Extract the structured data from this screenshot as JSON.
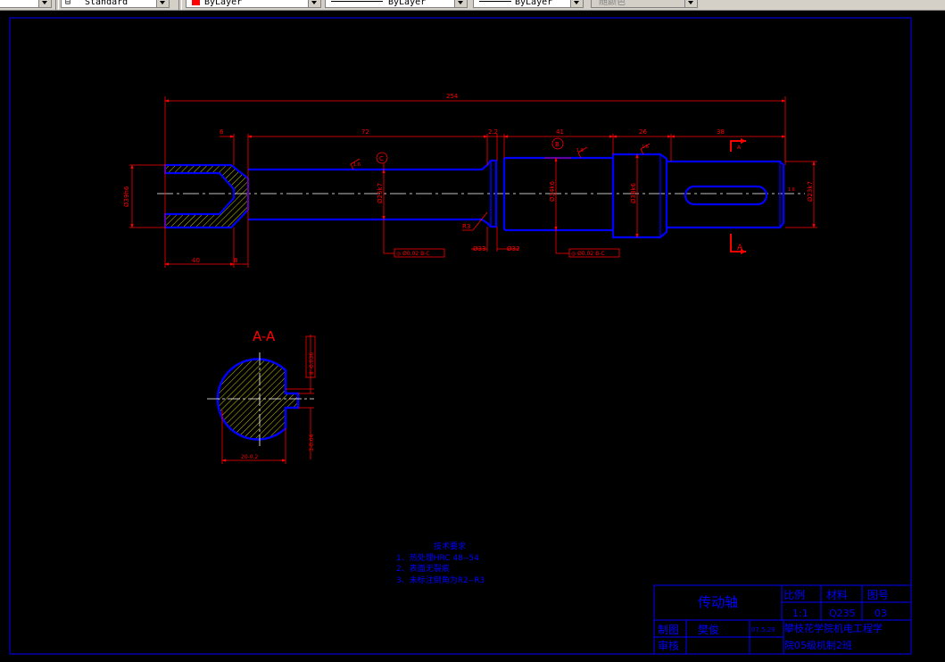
{
  "toolbar": {
    "text_style": "Standard",
    "color": "ByLayer",
    "color_swatch": "#ff0000",
    "linetype": "ByLayer",
    "lineweight": "ByLayer",
    "plot_style": "随颜色"
  },
  "colors": {
    "outline": "#0000ff",
    "dimension": "#ff0000",
    "centerline": "#ffffff",
    "hatch": "#ffff00"
  },
  "dims": {
    "overall": "254",
    "d6": "6",
    "d72": "72",
    "d2_2": "2.2",
    "d41": "41",
    "d26": "26",
    "d38": "38",
    "d40": "40",
    "d8": "8",
    "dia_left": "Ø39h6",
    "dia_mid": "Ø25k7",
    "dia_bearing": "Ø34k6",
    "dia_shoulder": "Ø38k6",
    "dia_right": "Ø23k7",
    "r3": "R3",
    "dia33": "Ø33",
    "dia32": "Ø32",
    "tol1": "◎ Ø0.02 B-C",
    "tol2": "◎ Ø0.02 B-C",
    "datum_c": "C",
    "datum_b": "B",
    "sec_a": "A",
    "rough1": "1.6",
    "rough2": "1.6",
    "rough3": "1.6",
    "rough4": "1.6"
  },
  "section": {
    "title": "A-A",
    "dim_width": "20-0.2",
    "dim_side1": "8 -0.036",
    "dim_side2": "3-0.04"
  },
  "notes": {
    "title": "技术要求",
    "line1": "1、热处理HRC 48--54",
    "line2": "2、表面无裂痕",
    "line3": "3、未标注倒角为R2--R3"
  },
  "title_block": {
    "name": "传动轴",
    "scale_label": "比例",
    "material_label": "材料",
    "drawing_no_label": "图号",
    "scale": "1:1",
    "material": "Q235",
    "drawing_no": "03",
    "drawn_label": "制图",
    "drawn_by": "樊俊",
    "date": "07.5.29",
    "checked_label": "审核",
    "school": "攀枝花学院机电工程学",
    "class": "院05级机制2班"
  }
}
